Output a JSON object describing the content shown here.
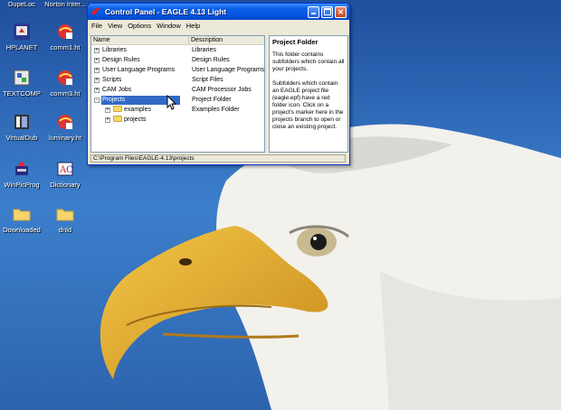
{
  "desktop": {
    "icons": [
      {
        "label": "DupeLoc",
        "icon": "app-icon"
      },
      {
        "label": "Norton Inter...",
        "icon": "norton-icon"
      },
      {
        "label": "HPLANET",
        "icon": "shortcut-icon"
      },
      {
        "label": "comm1.ht",
        "icon": "html-file-icon"
      },
      {
        "label": "TEXTCOMP",
        "icon": "app-icon"
      },
      {
        "label": "comm3.ht",
        "icon": "html-file-icon"
      },
      {
        "label": "VirtualDub",
        "icon": "app-icon"
      },
      {
        "label": "luminary.ht",
        "icon": "html-file-icon"
      },
      {
        "label": "WinPicProg",
        "icon": "app-icon"
      },
      {
        "label": "Dictionary",
        "icon": "app-icon"
      },
      {
        "label": "Downloaded",
        "icon": "folder-icon"
      },
      {
        "label": "dnld",
        "icon": "folder-icon"
      }
    ]
  },
  "window": {
    "title": "Control Panel - EAGLE 4.13 Light",
    "menu": [
      {
        "label": "File",
        "accel": "F"
      },
      {
        "label": "View",
        "accel": "V"
      },
      {
        "label": "Options",
        "accel": "O"
      },
      {
        "label": "Window",
        "accel": "W"
      },
      {
        "label": "Help",
        "accel": "H"
      }
    ],
    "columns": {
      "name": "Name",
      "description": "Description"
    },
    "tree": [
      {
        "name": "Libraries",
        "description": "Libraries",
        "expander": "+",
        "level": 0
      },
      {
        "name": "Design Rules",
        "description": "Design Rules",
        "expander": "+",
        "level": 0
      },
      {
        "name": "User Language Programs",
        "description": "User Language Programs",
        "expander": "+",
        "level": 0
      },
      {
        "name": "Scripts",
        "description": "Script Files",
        "expander": "+",
        "level": 0
      },
      {
        "name": "CAM Jobs",
        "description": "CAM Processor Jobs",
        "expander": "+",
        "level": 0
      },
      {
        "name": "Projects",
        "description": "Project Folder",
        "expander": "-",
        "level": 0,
        "selected": true
      },
      {
        "name": "examples",
        "description": "Examples Folder",
        "expander": "+",
        "level": 1
      },
      {
        "name": "projects",
        "description": "",
        "expander": "+",
        "level": 1
      }
    ],
    "info": {
      "heading": "Project Folder",
      "paragraph1": "This folder contains subfolders which contain all your projects.",
      "paragraph2": "Subfolders which contain an EAGLE project file (eagle.epf) have a red folder icon. Click on a project's marker here in the projects branch to open or close an existing project."
    },
    "status": "C:\\Program Files\\EAGLE-4.13\\projects"
  },
  "colors": {
    "titlebar": "#0554e2",
    "selection": "#316ac5",
    "desktop": "#2a66b8"
  }
}
